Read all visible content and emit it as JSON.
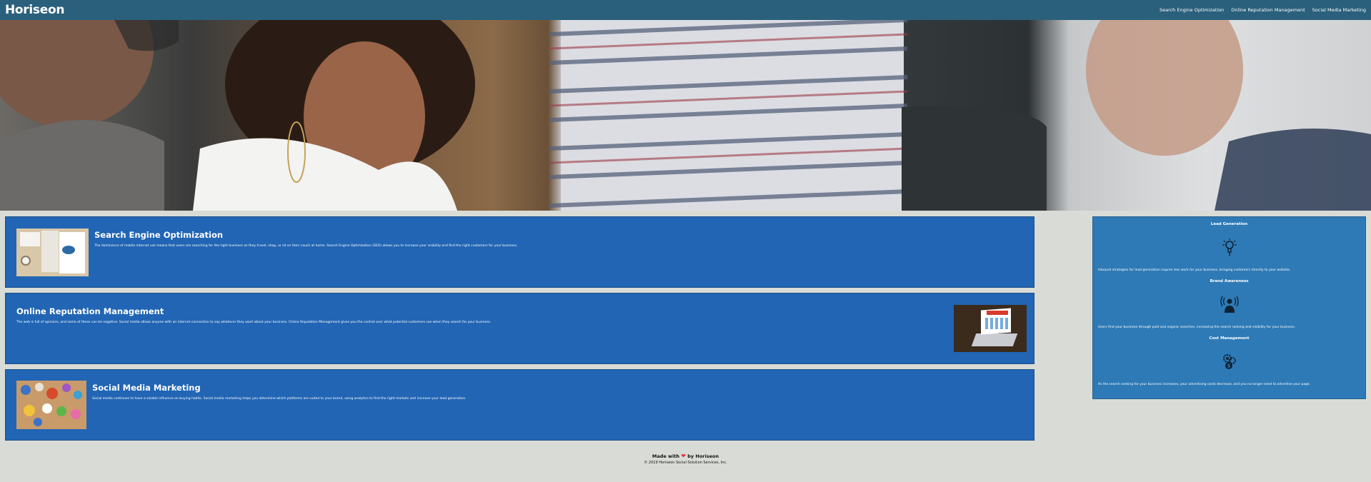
{
  "header": {
    "logo": "Horiseon",
    "nav": [
      {
        "label": "Search Engine Optimization"
      },
      {
        "label": "Online Reputation Management"
      },
      {
        "label": "Social Media Marketing"
      }
    ]
  },
  "cards": [
    {
      "title": "Search Engine Optimization",
      "text": "The dominance of mobile internet use means that users are searching for the right business as they travel, shop, or sit on their couch at home. Search Engine Optimization (SEO) allows you to increase your visibility and find the right customers for your business."
    },
    {
      "title": "Online Reputation Management",
      "text": "The web is full of opinions, and some of these can be negative. Social media allows anyone with an internet connection to say whatever they want about your business. Online Reputation Management gives you the control over what potential customers see when they search for your business."
    },
    {
      "title": "Social Media Marketing",
      "text": "Social media continues to have a sizable influence on buying habits. Social media marketing helps you determine which platforms are suited to your brand, using analytics to find the right markets and increase your lead generation."
    }
  ],
  "benefits": [
    {
      "title": "Lead Generation",
      "icon": "lightbulb-icon",
      "text": "Inbound strategies for lead generation require less work for your business, bringing customers directly to your website."
    },
    {
      "title": "Brand Awareness",
      "icon": "broadcast-person-icon",
      "text": "Users find your business through paid and organic searches, increasing the search ranking and visibility for your business."
    },
    {
      "title": "Cost Management",
      "icon": "gears-dollar-icon",
      "text": "As the search ranking for your business increases, your advertising costs decrease, and you no longer need to advertise your page."
    }
  ],
  "footer": {
    "made_prefix": "Made with",
    "made_suffix": "by Horiseon",
    "copyright": "© 2019 Horiseon Social Solution Services, Inc."
  },
  "colors": {
    "header": "#2a607c",
    "card": "#2165b4",
    "sidebar": "#2e7ab6",
    "background": "#d9dcd6",
    "heart": "#e1373d"
  }
}
